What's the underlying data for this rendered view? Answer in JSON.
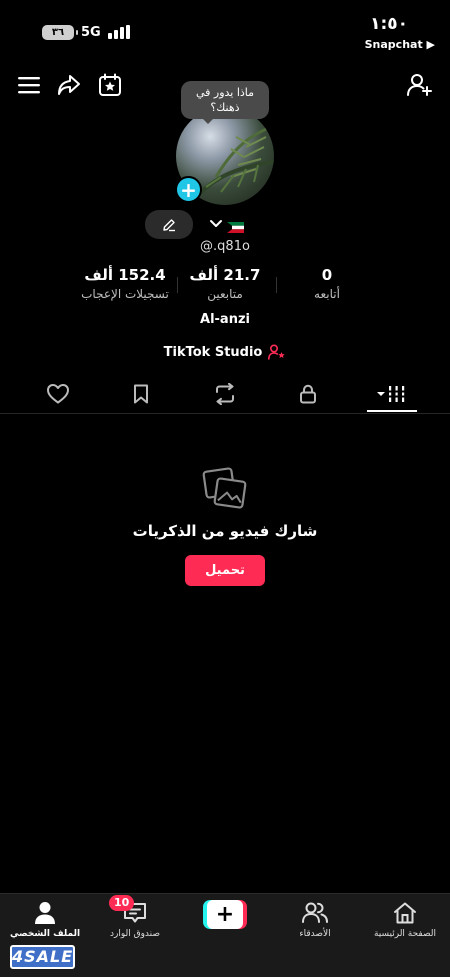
{
  "status_bar": {
    "time": "١:٥٠",
    "back_app": "Snapchat ▶",
    "network": "5G",
    "battery": "٣٦"
  },
  "header": {
    "icons": [
      "menu-icon",
      "share-icon",
      "calendar-star-icon",
      "add-friend-icon"
    ]
  },
  "profile": {
    "note_bubble": "ماذا يدور في ذهنك؟",
    "username": "@.q81o",
    "nickname": "Al-anzi",
    "studio_label": "TikTok Studio",
    "stats": {
      "following_value": "0",
      "following_label": "أتابعه",
      "followers_value": "21.7 ألف",
      "followers_label": "متابعين",
      "likes_value": "152.4 ألف",
      "likes_label": "تسجيلات الإعجاب"
    }
  },
  "tabs": {
    "items": [
      "videos-grid-icon",
      "lock-icon",
      "repost-icon",
      "bookmark-icon",
      "heart-icon"
    ],
    "active": "videos-grid-icon"
  },
  "empty_state": {
    "title": "شارك فيديو من الذكريات",
    "upload_label": "تحميل"
  },
  "bottom_nav": {
    "home": "الصفحة الرئيسية",
    "friends": "الأصدقاء",
    "inbox": "صندوق الوارد",
    "inbox_badge": "10",
    "profile": "الملف الشخصي",
    "active": "profile"
  },
  "watermark": "4SALE",
  "colors": {
    "accent": "#fe2c55",
    "cyan": "#25f4ee",
    "avatar_add": "#20c6e6",
    "background": "#000000"
  }
}
